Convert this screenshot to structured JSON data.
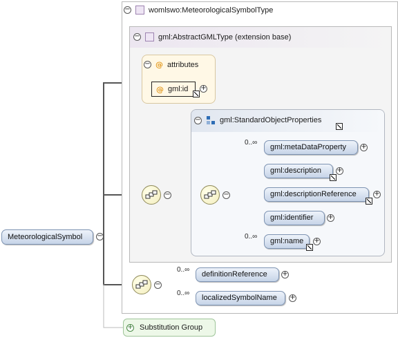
{
  "root": {
    "label": "MeteorologicalSymbol"
  },
  "type_box": {
    "title": "womlswo:MeteorologicalSymbolType"
  },
  "base_box": {
    "title": "gml:AbstractGMLType (extension base)"
  },
  "attributes": {
    "title": "attributes",
    "item": "gml:id"
  },
  "group": {
    "title": "gml:StandardObjectProperties",
    "items": [
      {
        "label": "gml:metaDataProperty",
        "occ": "0..∞"
      },
      {
        "label": "gml:description",
        "occ": ""
      },
      {
        "label": "gml:descriptionReference",
        "occ": ""
      },
      {
        "label": "gml:identifier",
        "occ": ""
      },
      {
        "label": "gml:name",
        "occ": "0..∞"
      }
    ]
  },
  "extension": {
    "items": [
      {
        "label": "definitionReference",
        "occ": "0..∞"
      },
      {
        "label": "localizedSymbolName",
        "occ": "0..∞"
      }
    ]
  },
  "substitution": {
    "label": "Substitution Group"
  },
  "glyphs": {
    "minus": "−",
    "plus": "+",
    "at": "@"
  },
  "icons": [
    "collapse-icon",
    "expand-icon",
    "complex-type-icon",
    "attribute-icon",
    "sequence-icon",
    "link-arrow-icon",
    "group-icon"
  ],
  "colors": {
    "element_fill": "#c6d4e8",
    "element_border": "#7d93b2",
    "attributes_fill": "#fff8e6",
    "substitution_fill": "#edf8e8",
    "connector": "#555555"
  }
}
